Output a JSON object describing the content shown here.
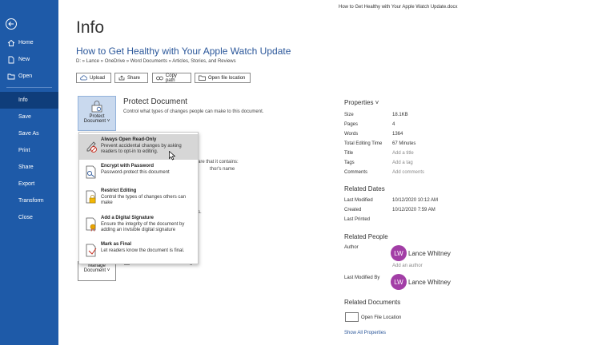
{
  "window": {
    "doc_title": "How to Get Healthy with Your Apple Watch Update.docx"
  },
  "sidebar": {
    "back_icon": "back-arrow-icon",
    "items": [
      {
        "label": "Home",
        "icon": "home-icon"
      },
      {
        "label": "New",
        "icon": "new-doc-icon"
      },
      {
        "label": "Open",
        "icon": "open-folder-icon"
      },
      {
        "label": "Info"
      },
      {
        "label": "Save"
      },
      {
        "label": "Save As"
      },
      {
        "label": "Print"
      },
      {
        "label": "Share"
      },
      {
        "label": "Export"
      },
      {
        "label": "Transform"
      },
      {
        "label": "Close"
      }
    ],
    "active": "Info",
    "color": "#1e5aa8",
    "active_color": "#0f3d7a"
  },
  "main": {
    "title": "Info",
    "doc_name": "How to Get Healthy with Your Apple Watch Update",
    "path": "D: » Lance » OneDrive » Word Documents » Articles, Stories, and Reviews",
    "actions": {
      "upload": "Upload",
      "share": "Share",
      "copy_path": "Copy path",
      "open_location": "Open file location"
    },
    "protect": {
      "button_line1": "Protect",
      "button_line2": "Document ˅",
      "title": "Protect Document",
      "desc": "Control what types of changes people can make to this document."
    },
    "hidden_fragments": {
      "inspect": "are that it contains:",
      "author_name": "thor's name",
      "s_fragment": "s.",
      "changes": "There are no unsaved changes."
    },
    "manage": {
      "line1": "Manage",
      "line2": "Document ˅"
    }
  },
  "dropdown": {
    "items": [
      {
        "title": "Always Open Read-Only",
        "desc": "Prevent accidental changes by asking readers to opt-in to editing.",
        "icon": "pencil-readonly-icon"
      },
      {
        "title": "Encrypt with Password",
        "desc": "Password-protect this document",
        "icon": "lock-key-icon"
      },
      {
        "title": "Restrict Editing",
        "desc": "Control the types of changes others can make",
        "icon": "restrict-lock-icon"
      },
      {
        "title": "Add a Digital Signature",
        "desc": "Ensure the integrity of the document by adding an invisible digital signature",
        "icon": "signature-icon"
      },
      {
        "title": "Mark as Final",
        "desc": "Let readers know the document is final.",
        "icon": "mark-final-icon"
      }
    ]
  },
  "properties": {
    "header": "Properties ˅",
    "rows": [
      {
        "key": "Size",
        "value": "18.1KB"
      },
      {
        "key": "Pages",
        "value": "4"
      },
      {
        "key": "Words",
        "value": "1364"
      },
      {
        "key": "Total Editing Time",
        "value": "67 Minutes"
      },
      {
        "key": "Title",
        "value": "Add a title"
      },
      {
        "key": "Tags",
        "value": "Add a tag"
      },
      {
        "key": "Comments",
        "value": "Add comments"
      }
    ],
    "related_dates": {
      "header": "Related Dates",
      "rows": [
        {
          "key": "Last Modified",
          "value": "10/12/2020 10:12 AM"
        },
        {
          "key": "Created",
          "value": "10/12/2020 7:59 AM"
        },
        {
          "key": "Last Printed",
          "value": ""
        }
      ]
    },
    "related_people": {
      "header": "Related People",
      "author_label": "Author",
      "author_initials": "LW",
      "author_name": "Lance Whitney",
      "add_author": "Add an author",
      "modified_label": "Last Modified By",
      "modified_initials": "LW",
      "modified_name": "Lance Whitney",
      "avatar_color": "#a23ea6"
    },
    "related_documents": {
      "header": "Related Documents",
      "open_location": "Open File Location",
      "show_all": "Show All Properties"
    }
  }
}
